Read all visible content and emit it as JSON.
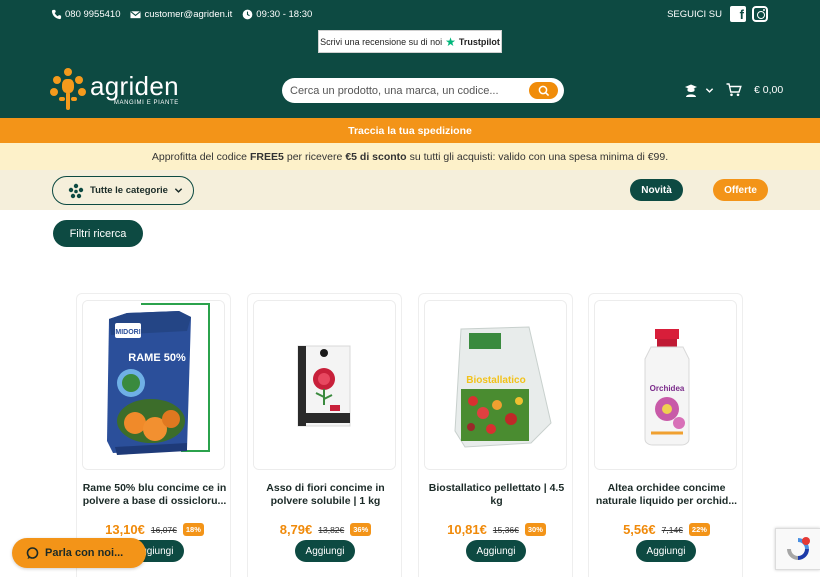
{
  "header": {
    "phone": "080 9955410",
    "email": "customer@agriden.it",
    "hours": "09:30 - 18:30",
    "follow_label": "SEGUICI SU",
    "trustpilot_text": "Scrivi una recensione su di noi",
    "trustpilot_brand": "Trustpilot",
    "logo_name": "agriden",
    "logo_sub": "MANGIMI E PIANTE",
    "search_placeholder": "Cerca un prodotto, una marca, un codice...",
    "cart_total": "€ 0,00",
    "brand_color": "#0d4a42",
    "accent_color": "#f39418"
  },
  "track_bar": {
    "label": "Traccia la tua spedizione"
  },
  "promo": {
    "part1": "Approfitta del codice",
    "code": "FREE5",
    "part2": "per ricevere",
    "amount": "€5 di sconto",
    "part3": "su tutti gli acquisti: valido con una spesa minima di €99."
  },
  "nav": {
    "categories_label": "Tutte le categorie",
    "novita_label": "Novità",
    "offerte_label": "Offerte"
  },
  "filters_label": "Filtri ricerca",
  "products": [
    {
      "title": "Rame 50% blu concime ce in polvere a base di ossicloru...",
      "price": "13,10€",
      "old_price": "16,07€",
      "discount": "18%",
      "button": "Aggiungi"
    },
    {
      "title": "Asso di fiori concime in polvere solubile | 1 kg",
      "price": "8,79€",
      "old_price": "13,82€",
      "discount": "36%",
      "button": "Aggiungi"
    },
    {
      "title": "Biostallatico pellettato | 4.5 kg",
      "price": "10,81€",
      "old_price": "15,36€",
      "discount": "30%",
      "button": "Aggiungi"
    },
    {
      "title": "Altea orchidee concime naturale liquido per orchid...",
      "price": "5,56€",
      "old_price": "7,14€",
      "discount": "22%",
      "button": "Aggiungi"
    }
  ],
  "product_images": [
    {
      "brand": "MIDORI",
      "label": "RAME 50%"
    },
    {
      "brand": "",
      "label": ""
    },
    {
      "brand": "",
      "label": "Biostallatico"
    },
    {
      "brand": "",
      "label": "Orchidea"
    }
  ],
  "chat_label": "Parla con noi..."
}
